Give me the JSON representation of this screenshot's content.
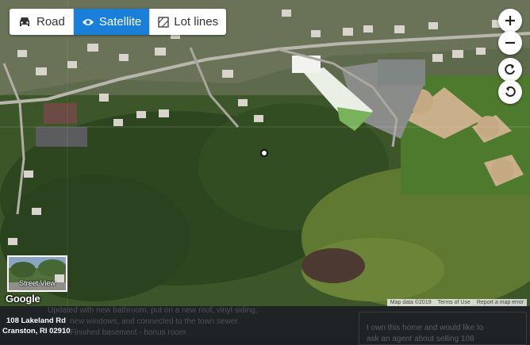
{
  "map": {
    "type_options": [
      {
        "label": "Road",
        "icon": "car-icon"
      },
      {
        "label": "Satellite",
        "icon": "eye-icon"
      },
      {
        "label": "Lot lines",
        "icon": "lot-lines-icon"
      }
    ],
    "active_type": "Satellite",
    "controls": [
      "zoom-in-icon",
      "zoom-out-icon",
      "rotate-left-icon",
      "rotate-right-icon"
    ],
    "street_view_label": "Street View",
    "logo": "Google",
    "attribution": [
      "Map data ©2019",
      "Terms of Use",
      "Report a map error"
    ]
  },
  "listing": {
    "address_line1": "108 Lakeland Rd",
    "address_line2": "Cranston, RI 02910",
    "background_text": [
      "Updated with new bathroom, put on a new roof, vinyl siding,",
      "new windows, and connected to the town sewer.",
      "Finished basement - bonus room"
    ],
    "message_lines": [
      "I own this home and would like to",
      "ask an agent about selling 108"
    ]
  },
  "colors": {
    "active_toggle": "#1a7fd8",
    "panel_bg": "#202326"
  }
}
